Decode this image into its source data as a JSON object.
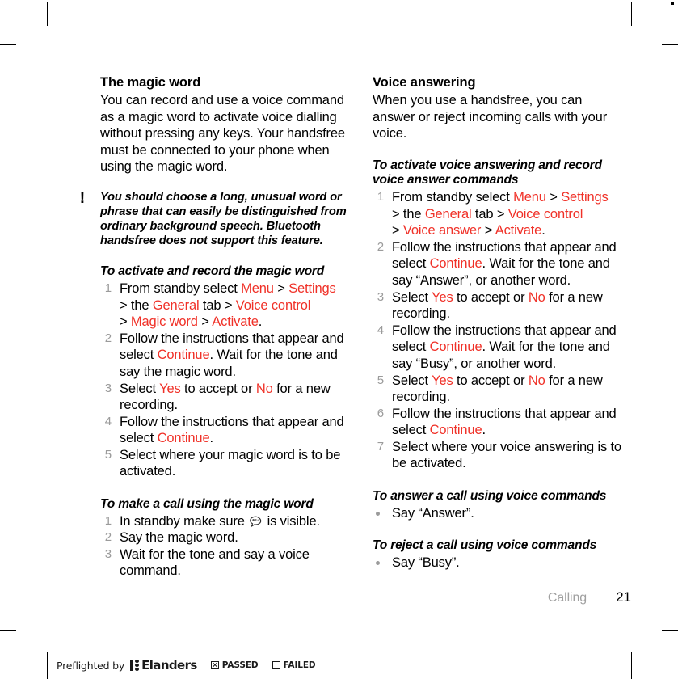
{
  "colors": {
    "ui_term_red": "#F03128",
    "step_number_gray": "#9b9b9b",
    "chapter_gray": "#a0a0a0",
    "text_black": "#000000"
  },
  "left_column": {
    "section_title": "The magic word",
    "intro": "You can record and use a voice command as a magic word to activate voice dialling without pressing any keys. Your handsfree must be connected to your phone when using the magic word.",
    "note": {
      "icon": "exclamation-icon",
      "icon_glyph": "!",
      "text": "You should choose a long, unusual word or phrase that can easily be distinguished from ordinary background speech. Bluetooth handsfree does not support this feature."
    },
    "procedure_1": {
      "heading": "To activate and record the magic word",
      "steps": [
        {
          "num": "1",
          "parts": [
            {
              "t": "From standby select ",
              "red": false
            },
            {
              "t": "Menu",
              "red": true
            },
            {
              "t": " > ",
              "red": false
            },
            {
              "t": "Settings",
              "red": true
            },
            {
              "t": "\n> the ",
              "red": false
            },
            {
              "t": "General",
              "red": true
            },
            {
              "t": " tab > ",
              "red": false
            },
            {
              "t": "Voice control",
              "red": true
            },
            {
              "t": "\n> ",
              "red": false
            },
            {
              "t": "Magic word",
              "red": true
            },
            {
              "t": " > ",
              "red": false
            },
            {
              "t": "Activate",
              "red": true
            },
            {
              "t": ".",
              "red": false
            }
          ]
        },
        {
          "num": "2",
          "parts": [
            {
              "t": "Follow the instructions that appear and select ",
              "red": false
            },
            {
              "t": "Continue",
              "red": true
            },
            {
              "t": ". Wait for the tone and say the magic word.",
              "red": false
            }
          ]
        },
        {
          "num": "3",
          "parts": [
            {
              "t": "Select ",
              "red": false
            },
            {
              "t": "Yes",
              "red": true
            },
            {
              "t": " to accept or ",
              "red": false
            },
            {
              "t": "No",
              "red": true
            },
            {
              "t": " for a new recording.",
              "red": false
            }
          ]
        },
        {
          "num": "4",
          "parts": [
            {
              "t": "Follow the instructions that appear and select ",
              "red": false
            },
            {
              "t": "Continue",
              "red": true
            },
            {
              "t": ".",
              "red": false
            }
          ]
        },
        {
          "num": "5",
          "parts": [
            {
              "t": "Select where your magic word is to be activated.",
              "red": false
            }
          ]
        }
      ]
    },
    "procedure_2": {
      "heading": "To make a call using the magic word",
      "steps": [
        {
          "num": "1",
          "parts": [
            {
              "t": "In standby make sure ",
              "red": false
            },
            {
              "t": "@ICON:speech-bubble-icon",
              "red": false
            },
            {
              "t": " is visible.",
              "red": false
            }
          ]
        },
        {
          "num": "2",
          "parts": [
            {
              "t": "Say the magic word.",
              "red": false
            }
          ]
        },
        {
          "num": "3",
          "parts": [
            {
              "t": "Wait for the tone and say a voice command.",
              "red": false
            }
          ]
        }
      ]
    }
  },
  "right_column": {
    "section_title": "Voice answering",
    "intro": "When you use a handsfree, you can answer or reject incoming calls with your voice.",
    "procedure_1": {
      "heading": "To activate voice answering and record voice answer commands",
      "steps": [
        {
          "num": "1",
          "parts": [
            {
              "t": "From standby select ",
              "red": false
            },
            {
              "t": "Menu",
              "red": true
            },
            {
              "t": " > ",
              "red": false
            },
            {
              "t": "Settings",
              "red": true
            },
            {
              "t": "\n> the ",
              "red": false
            },
            {
              "t": "General",
              "red": true
            },
            {
              "t": " tab > ",
              "red": false
            },
            {
              "t": "Voice control",
              "red": true
            },
            {
              "t": "\n> ",
              "red": false
            },
            {
              "t": "Voice answer",
              "red": true
            },
            {
              "t": " > ",
              "red": false
            },
            {
              "t": "Activate",
              "red": true
            },
            {
              "t": ".",
              "red": false
            }
          ]
        },
        {
          "num": "2",
          "parts": [
            {
              "t": "Follow the instructions that appear and select ",
              "red": false
            },
            {
              "t": "Continue",
              "red": true
            },
            {
              "t": ". Wait for the tone and say “Answer”, or another word.",
              "red": false
            }
          ]
        },
        {
          "num": "3",
          "parts": [
            {
              "t": "Select ",
              "red": false
            },
            {
              "t": "Yes",
              "red": true
            },
            {
              "t": " to accept or ",
              "red": false
            },
            {
              "t": "No",
              "red": true
            },
            {
              "t": " for a new recording.",
              "red": false
            }
          ]
        },
        {
          "num": "4",
          "parts": [
            {
              "t": "Follow the instructions that appear and select ",
              "red": false
            },
            {
              "t": "Continue",
              "red": true
            },
            {
              "t": ". Wait for the tone and say “Busy”, or another word.",
              "red": false
            }
          ]
        },
        {
          "num": "5",
          "parts": [
            {
              "t": "Select ",
              "red": false
            },
            {
              "t": "Yes",
              "red": true
            },
            {
              "t": " to accept or ",
              "red": false
            },
            {
              "t": "No",
              "red": true
            },
            {
              "t": " for a new recording.",
              "red": false
            }
          ]
        },
        {
          "num": "6",
          "parts": [
            {
              "t": "Follow the instructions that appear and select ",
              "red": false
            },
            {
              "t": "Continue",
              "red": true
            },
            {
              "t": ".",
              "red": false
            }
          ]
        },
        {
          "num": "7",
          "parts": [
            {
              "t": "Select where your voice answering is to be activated.",
              "red": false
            }
          ]
        }
      ]
    },
    "procedure_2": {
      "heading": "To answer a call using voice commands",
      "bullets": [
        "Say “Answer”."
      ]
    },
    "procedure_3": {
      "heading": "To reject a call using voice commands",
      "bullets": [
        "Say “Busy”."
      ]
    }
  },
  "footer": {
    "chapter": "Calling",
    "page_number": "21"
  },
  "preflight_bar": {
    "label": "Preflighted by",
    "logo_text": "Elanders",
    "logo_icon": "elanders-logo-icon",
    "passed_label": "PASSED",
    "passed_checked": true,
    "failed_label": "FAILED",
    "failed_checked": false
  }
}
